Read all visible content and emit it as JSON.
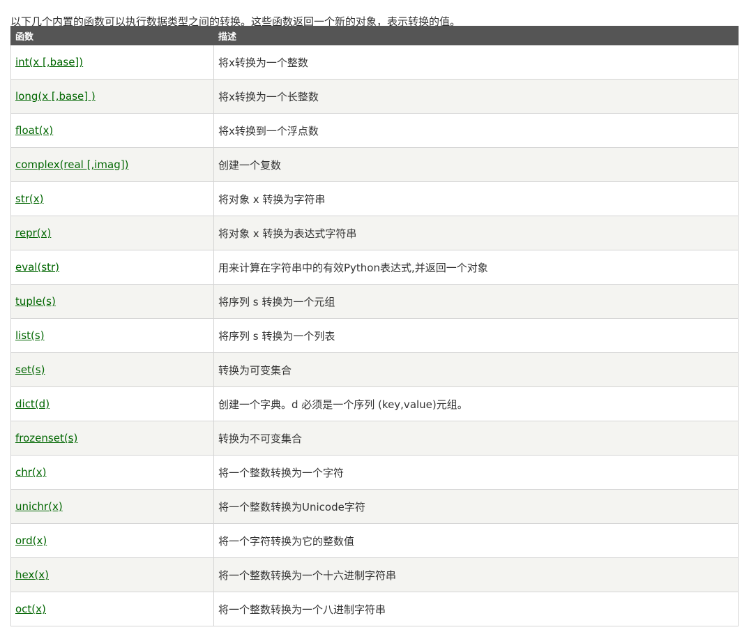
{
  "intro": "以下几个内置的函数可以执行数据类型之间的转换。这些函数返回一个新的对象，表示转换的值。",
  "table": {
    "headers": [
      "函数",
      "描述"
    ],
    "rows": [
      {
        "func": "int(x [,base])",
        "desc": "将x转换为一个整数"
      },
      {
        "func": "long(x [,base] )",
        "desc": "将x转换为一个长整数"
      },
      {
        "func": "float(x)",
        "desc": "将x转换到一个浮点数"
      },
      {
        "func": "complex(real [,imag])",
        "desc": "创建一个复数"
      },
      {
        "func": "str(x)",
        "desc": "将对象 x 转换为字符串"
      },
      {
        "func": "repr(x)",
        "desc": "将对象 x 转换为表达式字符串"
      },
      {
        "func": "eval(str)",
        "desc": "用来计算在字符串中的有效Python表达式,并返回一个对象"
      },
      {
        "func": "tuple(s)",
        "desc": "将序列 s 转换为一个元组"
      },
      {
        "func": "list(s)",
        "desc": "将序列 s 转换为一个列表"
      },
      {
        "func": "set(s)",
        "desc": "转换为可变集合"
      },
      {
        "func": "dict(d)",
        "desc": "创建一个字典。d 必须是一个序列 (key,value)元组。"
      },
      {
        "func": "frozenset(s)",
        "desc": "转换为不可变集合"
      },
      {
        "func": "chr(x)",
        "desc": "将一个整数转换为一个字符"
      },
      {
        "func": "unichr(x)",
        "desc": "将一个整数转换为Unicode字符"
      },
      {
        "func": "ord(x)",
        "desc": "将一个字符转换为它的整数值"
      },
      {
        "func": "hex(x)",
        "desc": "将一个整数转换为一个十六进制字符串"
      },
      {
        "func": "oct(x)",
        "desc": "将一个整数转换为一个八进制字符串"
      }
    ]
  },
  "colors": {
    "header_bg": "#555555",
    "link": "#006600",
    "row_alt": "#f4f4f1"
  }
}
